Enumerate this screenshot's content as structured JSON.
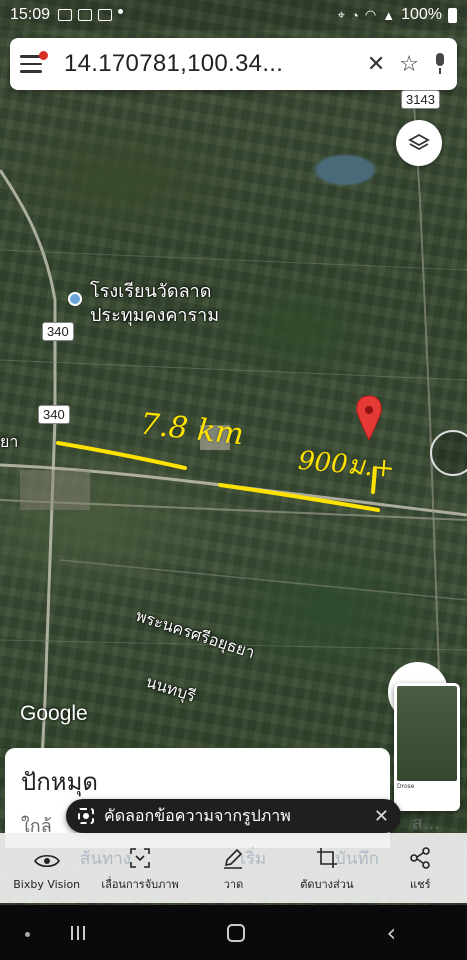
{
  "status_bar": {
    "time": "15:09",
    "battery": "100%",
    "icons": [
      "image-icon",
      "video-icon",
      "message-icon",
      "location-icon",
      "alarm-icon",
      "wifi-icon",
      "signal-icon",
      "battery-icon"
    ]
  },
  "search": {
    "query": "14.170781,100.34...",
    "icons": [
      "menu-icon",
      "close-icon",
      "star-icon",
      "mic-icon"
    ]
  },
  "map": {
    "road_shields": [
      "3143",
      "340",
      "340"
    ],
    "poi_name_line1": "โรงเรียนวัดลาด",
    "poi_name_line2": "ประทุมคงคาราม",
    "region_label_1": "พระนครศรีอยุธยา",
    "region_label_2": "นนทบุรี",
    "edge_label": "ยา",
    "logo": "Google",
    "annotation_distance": "7.8 km",
    "annotation_other": "900ม.+",
    "pin_color": "#e53935",
    "annotation_color": "#ffe300"
  },
  "bottom_sheet": {
    "title": "ปักหมุด",
    "subtitle": "ใกล้",
    "subtitle_right": "ส..."
  },
  "toast": {
    "text": "คัดลอกข้อความจากรูปภาพ"
  },
  "toolbar": {
    "items": [
      {
        "label": "Bixby Vision",
        "icon": "eye-icon"
      },
      {
        "label": "เลื่อนการจับภาพ",
        "icon": "scroll-capture-icon"
      },
      {
        "label": "วาด",
        "icon": "pen-icon"
      },
      {
        "label": "ตัดบางส่วน",
        "icon": "crop-icon"
      },
      {
        "label": "แชร์",
        "icon": "share-icon"
      }
    ],
    "behind_labels": [
      "ส้นทาง",
      "เริ่ม",
      "บันทึก"
    ]
  },
  "thumbnail": {
    "text": "Drose"
  }
}
